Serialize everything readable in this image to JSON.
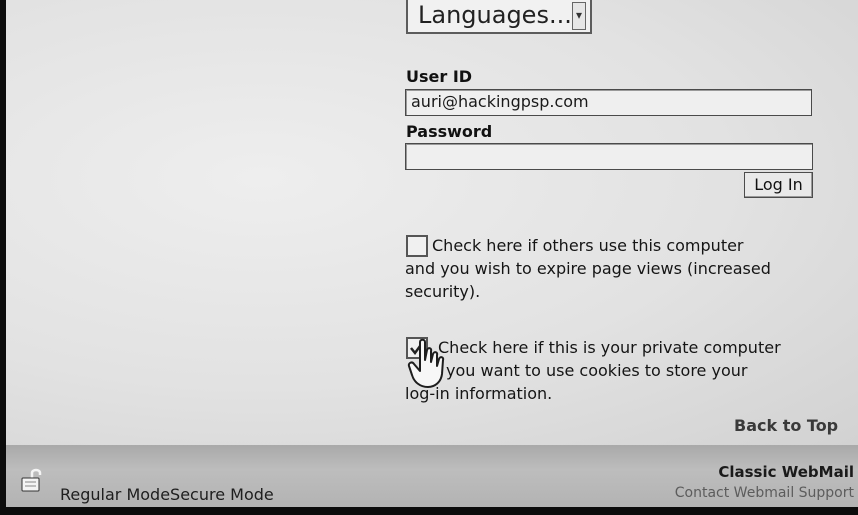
{
  "login_form": {
    "language_select": {
      "selected": "Languages..."
    },
    "user_id": {
      "label": "User ID",
      "value": "auri@hackingpsp.com"
    },
    "password": {
      "label": "Password",
      "value": ""
    },
    "login_button": "Log In"
  },
  "options": {
    "shared_computer": {
      "checked": false,
      "lines": [
        "Check here if others use this computer",
        "and you wish to expire page views (increased",
        "security)."
      ]
    },
    "private_computer": {
      "checked": true,
      "lines": [
        "Check here if this is your private computer",
        "you want to use cookies to store your",
        "log-in information."
      ]
    }
  },
  "back_to_top": "Back to Top",
  "footer": {
    "mode_text": "Regular ModeSecure Mode",
    "brand": "Classic WebMail",
    "links": "Contact Webmail Support"
  },
  "icons": {
    "lock": "lock-icon",
    "dropdown": "chevron-down-icon",
    "cursor": "hand-pointer-icon"
  }
}
